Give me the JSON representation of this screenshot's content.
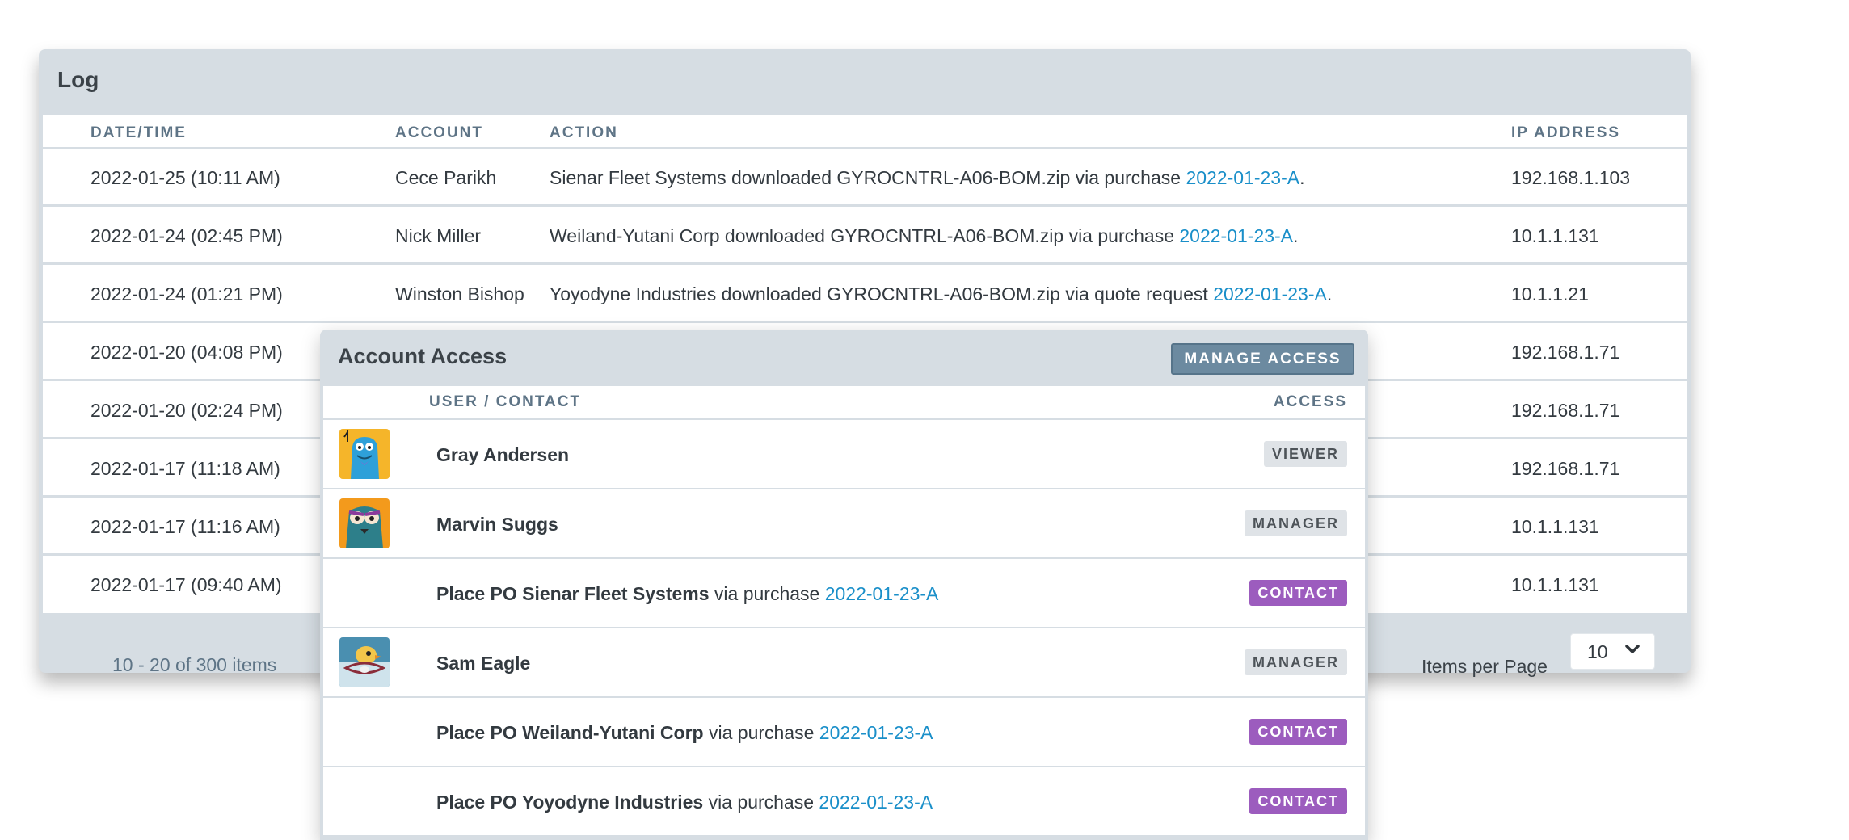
{
  "log": {
    "title": "Log",
    "columns": {
      "date": "DATE/TIME",
      "account": "ACCOUNT",
      "action": "ACTION",
      "ip": "IP ADDRESS"
    },
    "rows": [
      {
        "date": "2022-01-25 (10:11 AM)",
        "account": "Cece Parikh",
        "action_text": "Sienar Fleet Systems downloaded GYROCNTRL-A06-BOM.zip via purchase ",
        "action_link": "2022-01-23-A",
        "action_end": ".",
        "ip": "192.168.1.103"
      },
      {
        "date": "2022-01-24 (02:45 PM)",
        "account": "Nick Miller",
        "action_text": "Weiland-Yutani Corp downloaded GYROCNTRL-A06-BOM.zip via purchase ",
        "action_link": "2022-01-23-A",
        "action_end": ".",
        "ip": "10.1.1.131"
      },
      {
        "date": "2022-01-24 (01:21 PM)",
        "account": "Winston Bishop",
        "action_text": "Yoyodyne Industries downloaded GYROCNTRL-A06-BOM.zip via quote request ",
        "action_link": "2022-01-23-A",
        "action_end": ".",
        "ip": "10.1.1.21"
      },
      {
        "date": "2022-01-20 (04:08 PM)",
        "account": "",
        "action_text": "",
        "action_link": "",
        "action_end": "",
        "ip": "192.168.1.71"
      },
      {
        "date": "2022-01-20 (02:24 PM)",
        "account": "",
        "action_text": "",
        "action_link": "",
        "action_end": "",
        "ip": "192.168.1.71"
      },
      {
        "date": "2022-01-17 (11:18 AM)",
        "account": "",
        "action_text": "",
        "action_link": "",
        "action_end": "",
        "ip": "192.168.1.71"
      },
      {
        "date": "2022-01-17 (11:16 AM)",
        "account": "",
        "action_text": "",
        "action_link": "",
        "action_end": "",
        "ip": "10.1.1.131"
      },
      {
        "date": "2022-01-17 (09:40 AM)",
        "account": "",
        "action_text": "",
        "action_link": "",
        "action_end": "",
        "ip": "10.1.1.131"
      }
    ],
    "footer": {
      "items_count": "10 - 20 of 300 items",
      "per_page_label": "Items per Page",
      "per_page_value": "10"
    }
  },
  "access": {
    "title": "Account Access",
    "manage_button": "MANAGE ACCESS",
    "columns": {
      "user": "USER / CONTACT",
      "access": "ACCESS"
    },
    "rows": [
      {
        "avatar": "blue-monster-avatar",
        "bold": "Gray Andersen",
        "rest": "",
        "link": "",
        "badge": "VIEWER",
        "badge_style": "grey"
      },
      {
        "avatar": "owl-monster-avatar",
        "bold": "Marvin Suggs",
        "rest": "",
        "link": "",
        "badge": "MANAGER",
        "badge_style": "grey"
      },
      {
        "avatar": "",
        "bold": "Place PO Sienar Fleet Systems",
        "rest": " via purchase ",
        "link": "2022-01-23-A",
        "badge": "CONTACT",
        "badge_style": "purple"
      },
      {
        "avatar": "bird-avatar",
        "bold": "Sam Eagle",
        "rest": "",
        "link": "",
        "badge": "MANAGER",
        "badge_style": "grey"
      },
      {
        "avatar": "",
        "bold": "Place PO Weiland-Yutani Corp",
        "rest": " via purchase ",
        "link": "2022-01-23-A",
        "badge": "CONTACT",
        "badge_style": "purple"
      },
      {
        "avatar": "",
        "bold": "Place PO Yoyodyne Industries",
        "rest": " via purchase ",
        "link": "2022-01-23-A",
        "badge": "CONTACT",
        "badge_style": "purple"
      }
    ]
  },
  "colors": {
    "panel_bg": "#d6dde3",
    "link": "#1a8fc9",
    "contact_badge": "#9c5cbe",
    "manage_button": "#6c8aa0"
  }
}
